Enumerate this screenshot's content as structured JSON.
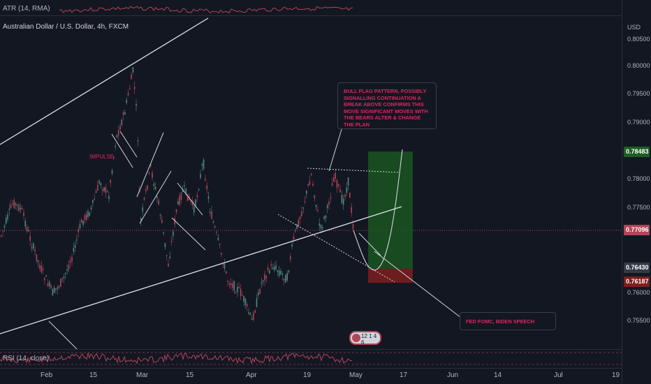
{
  "header": {
    "atr_label": "ATR (14, RMA)",
    "symbol_title": "Australian Dollar / U.S. Dollar, 4h, FXCM",
    "currency": "USD"
  },
  "price_axis": {
    "ticks": [
      "0.80500",
      "0.80000",
      "0.79500",
      "0.79000",
      "0.78000",
      "0.77500",
      "0.76000",
      "0.75500"
    ],
    "tags": {
      "green": "0.78483",
      "current": "0.77096",
      "gray": "0.76430",
      "red": "0.76187"
    }
  },
  "time_axis": {
    "ticks": [
      "Feb",
      "15",
      "Mar",
      "15",
      "Apr",
      "19",
      "May",
      "17",
      "Jun",
      "14",
      "Jul",
      "19"
    ]
  },
  "annotations": {
    "impulse": "IMPULSE",
    "bull_flag": "BULL FLAG PATTERN, POSSIBLY SIGNALLING CONTINUATION A BREAK ABOVE CONFIRMS THIS MOVE SIGNIFICANT MOVES WITH THE BEARS ALTER & CHANGE THE PLAN",
    "fed": "FED FOMC, BIDEN SPEECH"
  },
  "events_badge": "12  1 4 6",
  "rsi_label": "RSI (14, close)",
  "colors": {
    "background": "#131722",
    "up_candle": "#4e8a80",
    "down_candle": "#b24457",
    "profit_zone": "#1b5e20",
    "loss_zone": "#7f1d1d",
    "current_price_line": "#b24457",
    "annotation_text": "#e0245e"
  }
}
